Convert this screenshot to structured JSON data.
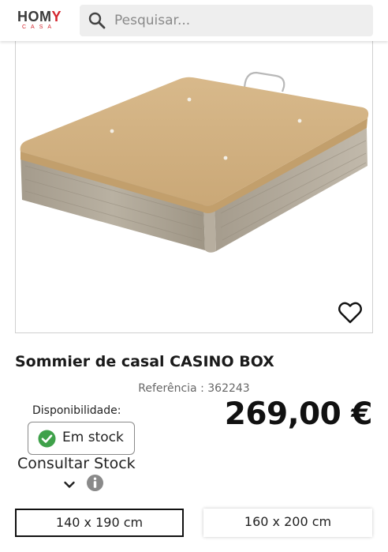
{
  "header": {
    "logo_main_pre": "HOM",
    "logo_main_accent": "Y",
    "logo_sub": "CASA",
    "search_placeholder": "Pesquisar..."
  },
  "product": {
    "title": "Sommier de casal CASINO BOX",
    "reference": "Referência : 362243",
    "price": "269,00 €",
    "availability_label": "Disponibilidade:",
    "stock_status": "Em stock",
    "consult_stock": "Consultar Stock"
  },
  "sizes": [
    {
      "label": "140 x 190 cm",
      "selected": true
    },
    {
      "label": "160 x 200 cm",
      "selected": false
    }
  ],
  "icons": {
    "search": "search-icon",
    "favorite": "heart-icon",
    "stock": "check-circle-icon",
    "expand": "chevron-down-icon",
    "info": "info-icon"
  },
  "colors": {
    "brand_red": "#d4262e",
    "stock_green": "#3fa14a"
  }
}
